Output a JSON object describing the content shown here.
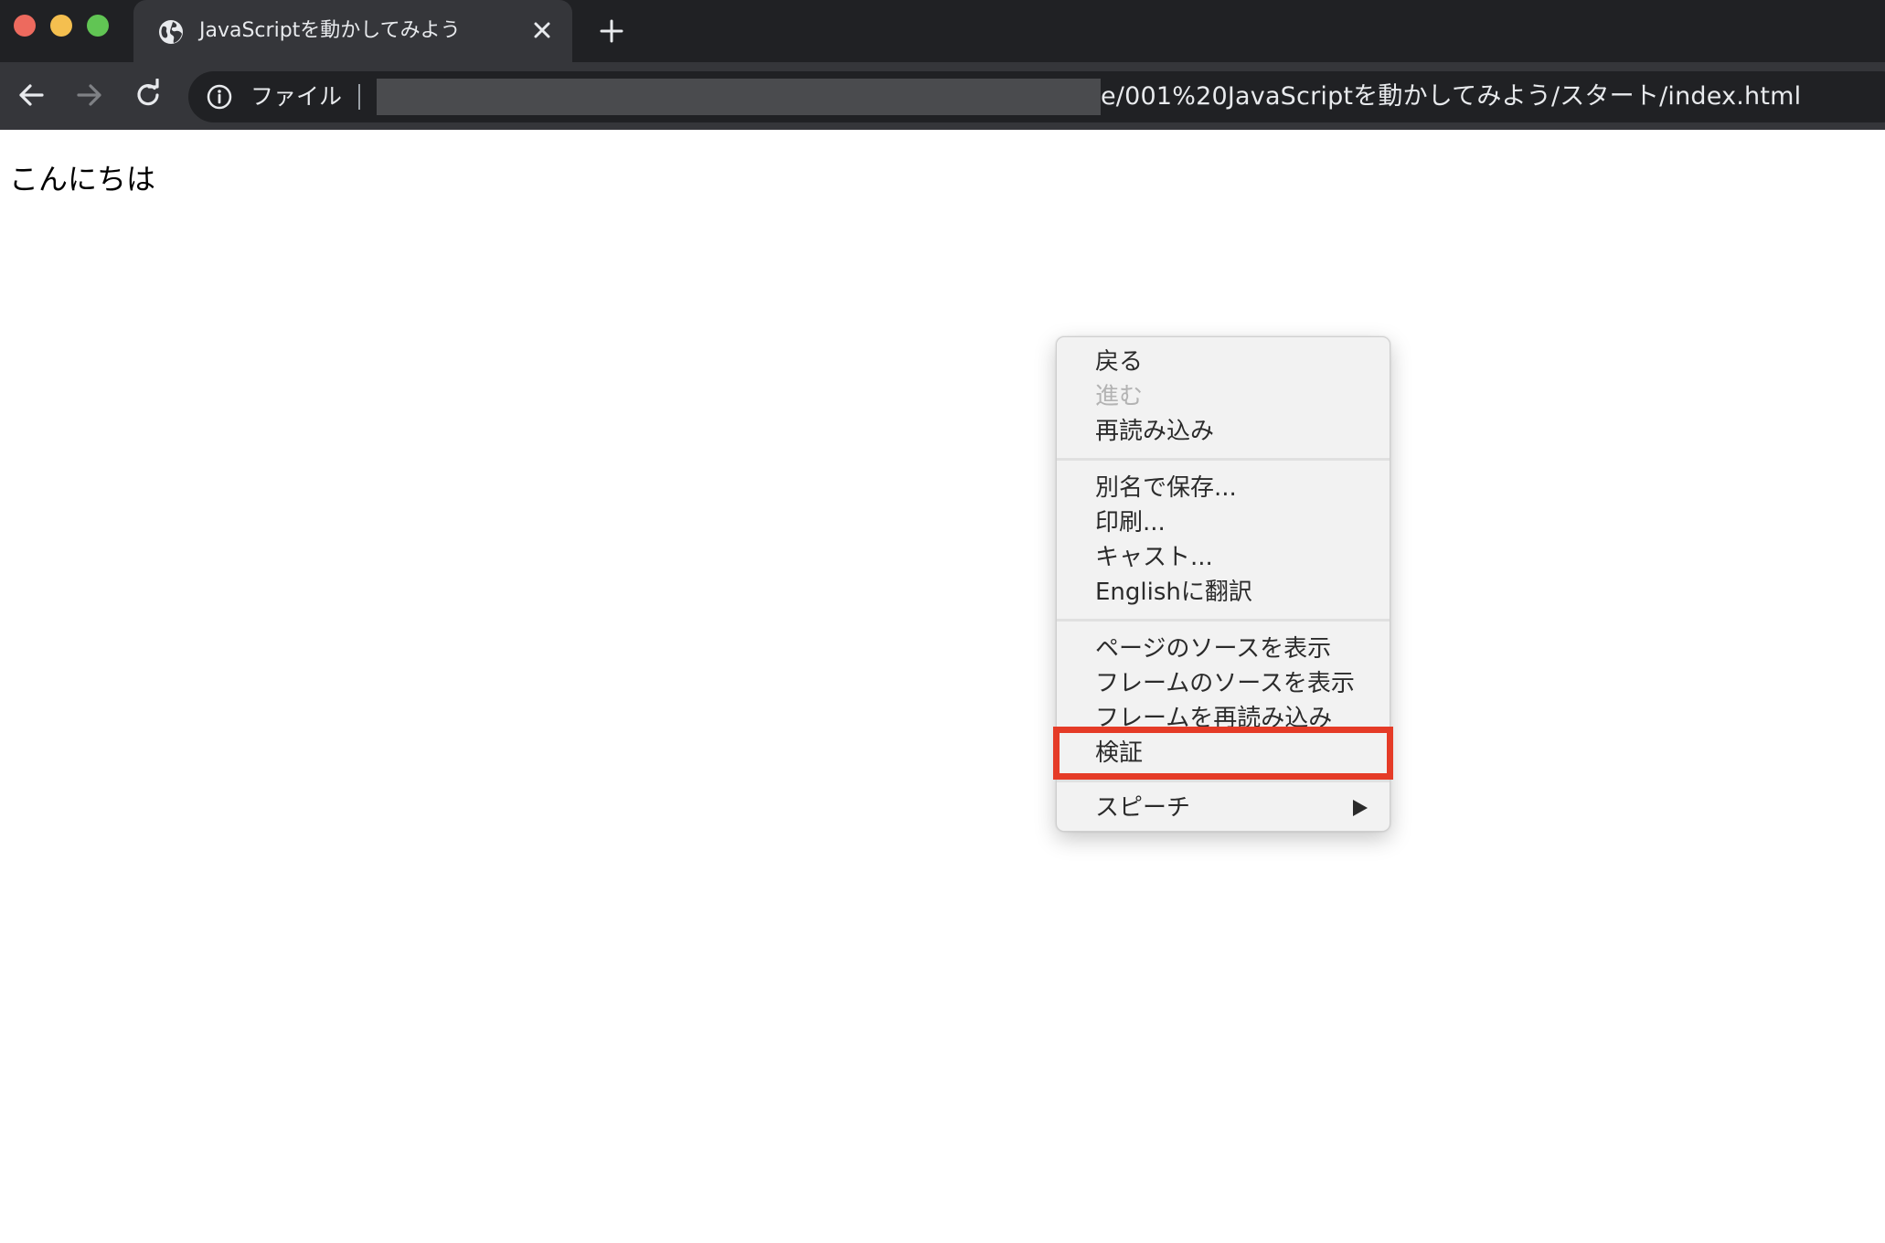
{
  "browser": {
    "tab": {
      "title": "JavaScriptを動かしてみよう"
    },
    "address_bar": {
      "chip_label": "ファイル",
      "url_visible": "e/001%20JavaScriptを動かしてみよう/スタート/index.html"
    }
  },
  "page": {
    "text": "こんにちは"
  },
  "context_menu": {
    "items": {
      "back": "戻る",
      "forward": "進む",
      "reload": "再読み込み",
      "save_as": "別名で保存...",
      "print": "印刷...",
      "cast": "キャスト...",
      "translate": "Englishに翻訳",
      "view_page_source": "ページのソースを表示",
      "view_frame_source": "フレームのソースを表示",
      "reload_frame": "フレームを再読み込み",
      "inspect": "検証",
      "speech": "スピーチ"
    },
    "forward_disabled": true,
    "highlighted_item": "検証",
    "highlight_color": "#e53b27"
  },
  "icons": {
    "tab_favicon": "globe-icon",
    "tab_close": "close-icon",
    "new_tab": "plus-icon",
    "back": "arrow-left-icon",
    "forward": "arrow-right-icon",
    "reload": "reload-icon",
    "site_info": "info-icon",
    "submenu": "submenu-arrow-icon"
  }
}
